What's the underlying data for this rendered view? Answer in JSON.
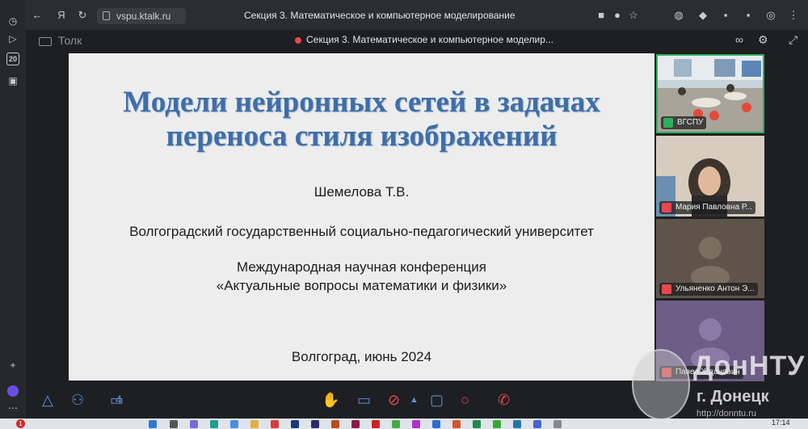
{
  "browser": {
    "url": "vspu.ktalk.ru",
    "tab_title": "Секция 3. Математическое и компьютерное моделирование",
    "sidebar_badge": "20"
  },
  "meeting": {
    "app_name": "Толк",
    "title": "Секция 3. Математическое и компьютерное моделир...",
    "participants_count": "4"
  },
  "slide": {
    "title_line1": "Модели нейронных сетей в задачах",
    "title_line2": "переноса стиля изображений",
    "author": "Шемелова Т.В.",
    "university": "Волгоградский государственный социально-педагогический университет",
    "conference_line1": "Международная научная конференция",
    "conference_line2": "«Актуальные вопросы математики и физики»",
    "place_date": "Волгоград, июнь 2024"
  },
  "participants": [
    {
      "name": "ВГСПУ",
      "mic": "on"
    },
    {
      "name": "Мария Павловна Р...",
      "mic": "off"
    },
    {
      "name": "Ульяненко Антон Э...",
      "mic": "off"
    },
    {
      "name": "Павел Жданович",
      "mic": "off"
    }
  ],
  "watermark": {
    "line1": "ДонНТУ",
    "line2": "г. Донецк",
    "line3": "http://donntu.ru"
  },
  "taskbar": {
    "time": "17:14",
    "notification_count": "1"
  },
  "colors": {
    "accent": "#5b8fd6",
    "danger": "#e5484d",
    "slide_title": "#3f6ea8"
  }
}
